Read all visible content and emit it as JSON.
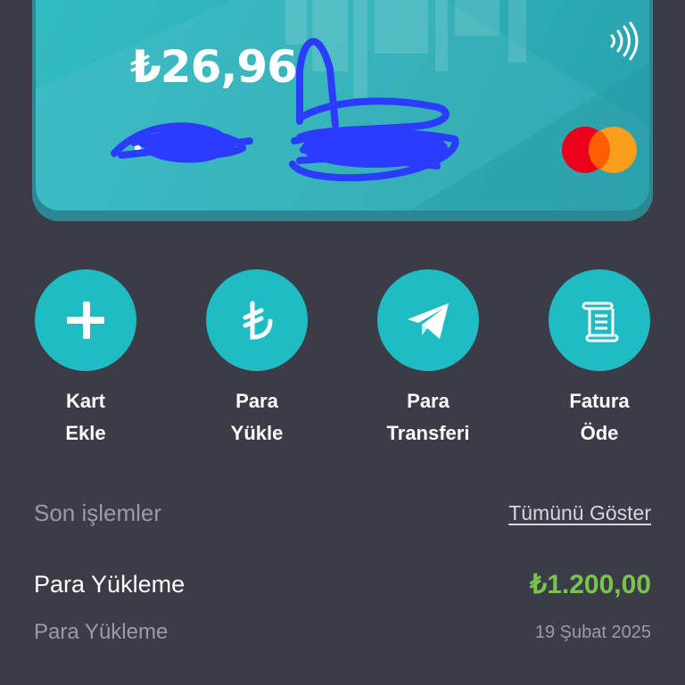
{
  "card": {
    "balance": "₺26,96",
    "masked_number": "••",
    "brand_icon": "mastercard-logo",
    "contactless_icon": "contactless-icon",
    "colors": {
      "card": "#2fb1b9",
      "mc_red": "#eb001b",
      "mc_orange": "#f79e1b",
      "redaction": "#2b3cff"
    }
  },
  "actions": [
    {
      "icon": "plus-icon",
      "line1": "Kart",
      "line2": "Ekle"
    },
    {
      "icon": "lira-icon",
      "line1": "Para",
      "line2": "Yükle"
    },
    {
      "icon": "paper-plane-icon",
      "line1": "Para",
      "line2": "Transferi"
    },
    {
      "icon": "receipt-icon",
      "line1": "Fatura",
      "line2": "Öde"
    }
  ],
  "recent": {
    "title": "Son işlemler",
    "show_all": "Tümünü Göster",
    "transactions": [
      {
        "title": "Para Yükleme",
        "subtitle": "Para Yükleme",
        "amount": "₺1.200,00",
        "date": "19 Şubat 2025"
      }
    ]
  },
  "colors": {
    "background": "#3a3c47",
    "accent": "#1fbcc4",
    "positive": "#7bc44a"
  }
}
